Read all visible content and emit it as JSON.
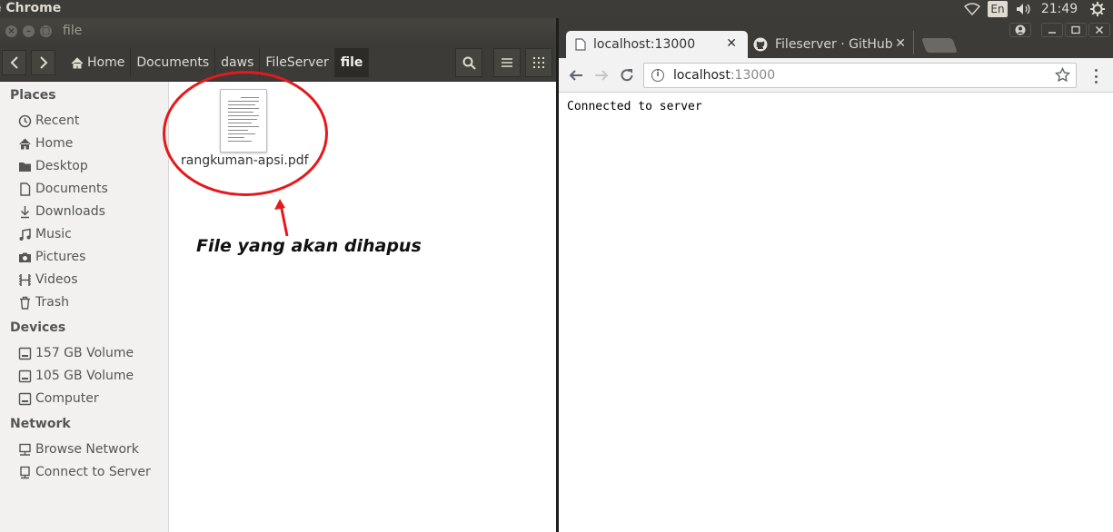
{
  "top_panel": {
    "app_name": "e Chrome",
    "keyboard_layout": "En",
    "clock": "21:49"
  },
  "file_manager": {
    "window_title": "file",
    "breadcrumbs": [
      "Home",
      "Documents",
      "daws",
      "FileServer",
      "file"
    ],
    "sidebar": {
      "places_label": "Places",
      "places": [
        {
          "label": "Recent",
          "icon": "clock-icon"
        },
        {
          "label": "Home",
          "icon": "home-icon"
        },
        {
          "label": "Desktop",
          "icon": "folder-icon"
        },
        {
          "label": "Documents",
          "icon": "document-icon"
        },
        {
          "label": "Downloads",
          "icon": "download-icon"
        },
        {
          "label": "Music",
          "icon": "music-icon"
        },
        {
          "label": "Pictures",
          "icon": "camera-icon"
        },
        {
          "label": "Videos",
          "icon": "film-icon"
        },
        {
          "label": "Trash",
          "icon": "trash-icon"
        }
      ],
      "devices_label": "Devices",
      "devices": [
        {
          "label": "157 GB Volume",
          "icon": "drive-icon"
        },
        {
          "label": "105 GB Volume",
          "icon": "drive-icon"
        },
        {
          "label": "Computer",
          "icon": "drive-icon"
        }
      ],
      "network_label": "Network",
      "network": [
        {
          "label": "Browse Network",
          "icon": "network-icon"
        },
        {
          "label": "Connect to Server",
          "icon": "server-icon"
        }
      ]
    },
    "files": [
      {
        "name": "rangkuman-apsi.pdf",
        "icon": "pdf-document-icon"
      }
    ],
    "annotation": {
      "text": "File yang akan dihapus",
      "color": "#e4191c"
    }
  },
  "browser": {
    "tabs": [
      {
        "title": "localhost:13000",
        "icon": "page-icon",
        "active": true
      },
      {
        "title": "Fileserver · GitHub",
        "icon": "github-icon",
        "active": false
      }
    ],
    "address": {
      "host": "localhost",
      "port": ":13000"
    },
    "page_text": "Connected to server"
  }
}
